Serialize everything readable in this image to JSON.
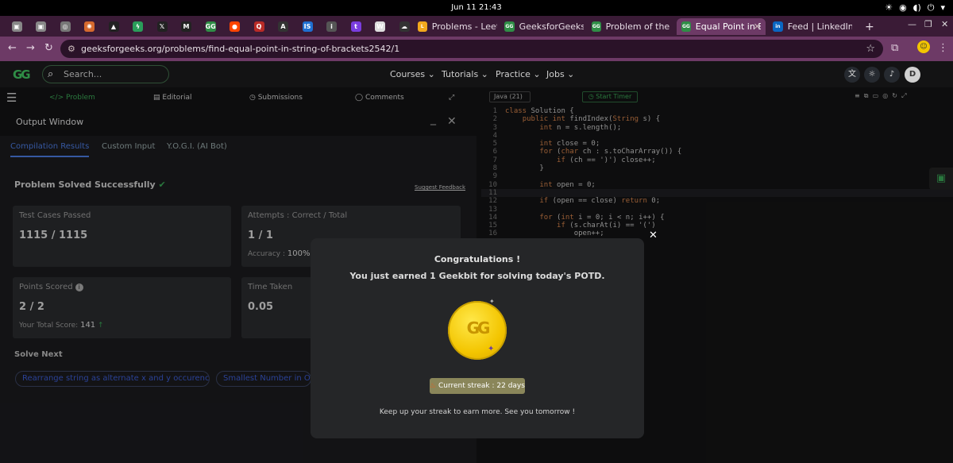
{
  "system": {
    "clock": "Jun 11  21:43",
    "tray": [
      "☀",
      "◉",
      "◖)",
      "⏻",
      "▾"
    ]
  },
  "browser": {
    "pinned_tabs": [
      {
        "icon": "site-icon-1",
        "color": "#888",
        "label": "▣"
      },
      {
        "icon": "site-icon-2",
        "color": "#888",
        "label": "▣"
      },
      {
        "icon": "spiral-icon",
        "color": "#777",
        "label": "◎"
      },
      {
        "icon": "sparkle-icon",
        "color": "#d56a2e",
        "label": "✺"
      },
      {
        "icon": "triangle-icon",
        "color": "#222",
        "label": "▲"
      },
      {
        "icon": "bolt-icon",
        "color": "#2a9d5a",
        "label": "ϟ"
      },
      {
        "icon": "x-icon",
        "color": "#222",
        "label": "𝕏"
      },
      {
        "icon": "medium-icon",
        "color": "#222",
        "label": "M"
      },
      {
        "icon": "gfg-icon",
        "color": "#2f8d46",
        "label": "GG"
      },
      {
        "icon": "reddit-icon",
        "color": "#ff4500",
        "label": "●"
      },
      {
        "icon": "quora-icon",
        "color": "#b92b27",
        "label": "Q"
      },
      {
        "icon": "a-icon",
        "color": "#333",
        "label": "A"
      },
      {
        "icon": "is-icon",
        "color": "#1f6fd1",
        "label": "IS"
      },
      {
        "icon": "info-icon",
        "color": "#555",
        "label": "i"
      },
      {
        "icon": "t-icon",
        "color": "#7a3de0",
        "label": "t"
      },
      {
        "icon": "w-icon",
        "color": "#ddd",
        "label": "W"
      },
      {
        "icon": "cloud-icon",
        "color": "#333",
        "label": "☁"
      }
    ],
    "tabs": [
      {
        "icon": "leetcode-icon",
        "title": "Problems - Leetc",
        "active": false,
        "color": "#f2a81d"
      },
      {
        "icon": "gfg-icon",
        "title": "GeeksforGeeks",
        "active": false,
        "color": "#2f8d46"
      },
      {
        "icon": "gfg-icon",
        "title": "Problem of the D",
        "active": false,
        "color": "#2f8d46"
      },
      {
        "icon": "gfg-icon",
        "title": "Equal Point in Br",
        "active": true,
        "color": "#2f8d46"
      },
      {
        "icon": "linkedin-icon",
        "title": "Feed | LinkedIn",
        "active": false,
        "color": "#0a66c2"
      }
    ],
    "new_tab": "+",
    "window_controls": [
      "—",
      "❐",
      "✕"
    ],
    "url": "geeksforgeeks.org/problems/find-equal-point-in-string-of-brackets2542/1"
  },
  "gfg": {
    "logo": "GG",
    "search_placeholder": "Search...",
    "menu": [
      "Courses",
      "Tutorials",
      "Practice",
      "Jobs"
    ],
    "avatar": "D"
  },
  "problem_tabs": [
    "</> Problem",
    "Editorial",
    "Submissions",
    "Comments"
  ],
  "output": {
    "title": "Output Window",
    "tabs": [
      "Compilation Results",
      "Custom Input",
      "Y.O.G.I. (AI Bot)"
    ],
    "status": "Problem Solved Successfully",
    "feedback": "Suggest Feedback",
    "cards": {
      "tests_label": "Test Cases Passed",
      "tests_value": "1115 / 1115",
      "attempts_label": "Attempts : Correct / Total",
      "attempts_value": "1 / 1",
      "accuracy_label": "Accuracy :",
      "accuracy_value": "100%",
      "points_label": "Points Scored",
      "points_value": "2 / 2",
      "total_label": "Your Total Score:",
      "total_value": "141",
      "time_label": "Time Taken",
      "time_value": "0.05"
    },
    "solve_next_title": "Solve Next",
    "solve_next": [
      "Rearrange string as alternate x and y occurences",
      "Smallest Number in Or"
    ]
  },
  "editor": {
    "language": "Java (21)",
    "timer": "Start Timer",
    "lines": [
      "class Solution {",
      "    public int findIndex(String s) {",
      "        int n = s.length();",
      "",
      "        int close = 0;",
      "        for (char ch : s.toCharArray()) {",
      "            if (ch == ')') close++;",
      "        }",
      "",
      "        int open = 0;",
      "",
      "        if (open == close) return 0;",
      "",
      "        for (int i = 0; i < n; i++) {",
      "            if (s.charAt(i) == '(')",
      "                open++;"
    ]
  },
  "modal": {
    "title": "Congratulations !",
    "subtitle": "You just earned 1 Geekbit for solving today's POTD.",
    "coin": "GG",
    "streak": "Current streak : 22 days",
    "footer": "Keep up your streak to earn more. See you tomorrow !",
    "close": "✕"
  },
  "colors": {
    "accent": "#2f8d46",
    "tab_bar": "#3a1b36",
    "address_bar": "#6d3a66",
    "coin": "#f3c500"
  }
}
